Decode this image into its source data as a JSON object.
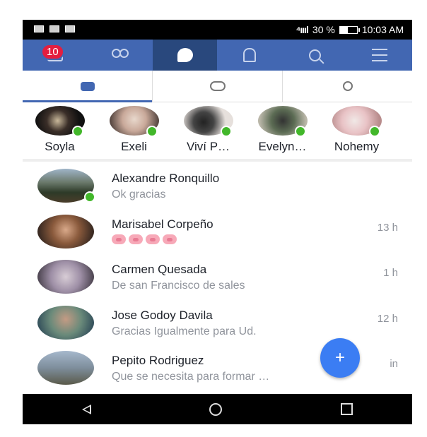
{
  "status_bar": {
    "signal": "⁴ıııl",
    "battery_text": "30 %",
    "time": "10:03 AM"
  },
  "header": {
    "news_badge": "10"
  },
  "active_users": [
    {
      "name": "Soyla"
    },
    {
      "name": "Exeli"
    },
    {
      "name": "Viví P…"
    },
    {
      "name": "Evelyn…"
    },
    {
      "name": "Nohemy"
    }
  ],
  "conversations": [
    {
      "name": "Alexandre Ronquillo",
      "snippet": "Ok gracias",
      "time": "",
      "online": true
    },
    {
      "name": "Marisabel Corpeño",
      "snippet": "",
      "time": "13 h",
      "online": false,
      "emoji": "pig-face x4"
    },
    {
      "name": "Carmen Quesada",
      "snippet": "De san Francisco de sales",
      "time": "1 h",
      "online": false
    },
    {
      "name": "Jose Godoy Davila",
      "snippet": "Gracias Igualmente para Ud.",
      "time": "12 h",
      "online": false
    },
    {
      "name": "Pepito Rodriguez",
      "snippet": "Que se necesita para formar …",
      "time": "in",
      "online": false
    }
  ],
  "fab": {
    "label": "+"
  },
  "colors": {
    "brand": "#4267b2",
    "brand_active": "#29487d",
    "online": "#42b72a",
    "fab": "#3b7df3"
  }
}
